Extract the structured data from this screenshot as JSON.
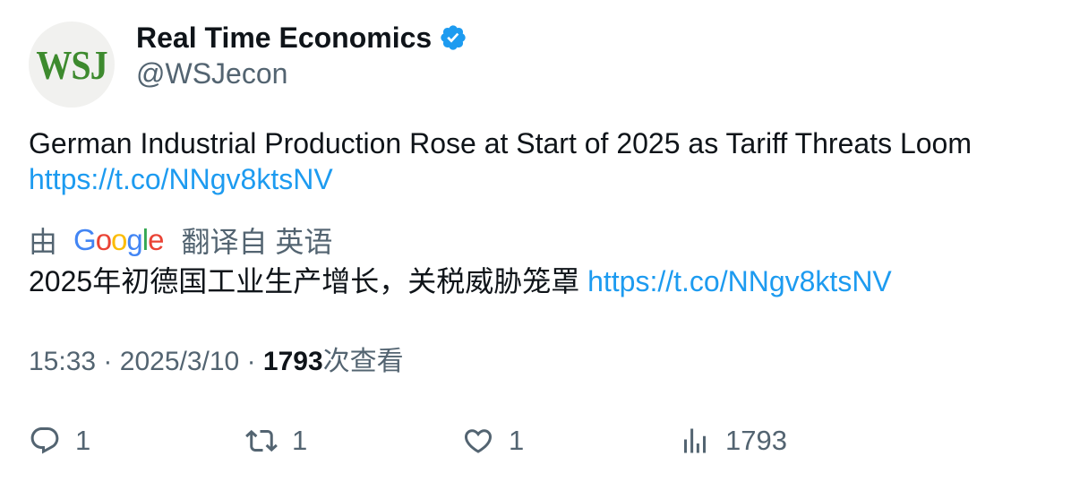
{
  "author": {
    "avatar_text": "WSJ",
    "display_name": "Real Time Economics",
    "handle": "@WSJecon",
    "verified_icon": "verified-badge-icon"
  },
  "tweet": {
    "text": "German Industrial Production Rose at Start of 2025 as Tariff Threats Loom",
    "link": "https://t.co/NNgv8ktsNV"
  },
  "translation": {
    "by_label": "由",
    "google_letters": [
      "G",
      "o",
      "o",
      "g",
      "l",
      "e"
    ],
    "from_label": "翻译自 英语",
    "text": "2025年初德国工业生产增长，关税威胁笼罩",
    "link": "https://t.co/NNgv8ktsNV"
  },
  "meta": {
    "time": "15:33",
    "separator": "·",
    "date": "2025/3/10",
    "views_count": "1793",
    "views_label": "次查看"
  },
  "actions": {
    "reply": {
      "icon": "reply-icon",
      "count": "1"
    },
    "retweet": {
      "icon": "retweet-icon",
      "count": "1"
    },
    "like": {
      "icon": "heart-icon",
      "count": "1"
    },
    "views": {
      "icon": "analytics-icon",
      "count": "1793"
    }
  },
  "colors": {
    "link": "#1d9bf0",
    "secondary_text": "#536471",
    "primary_text": "#0f1419",
    "verified": "#1d9bf0",
    "avatar_brand": "#3d8a2e"
  }
}
